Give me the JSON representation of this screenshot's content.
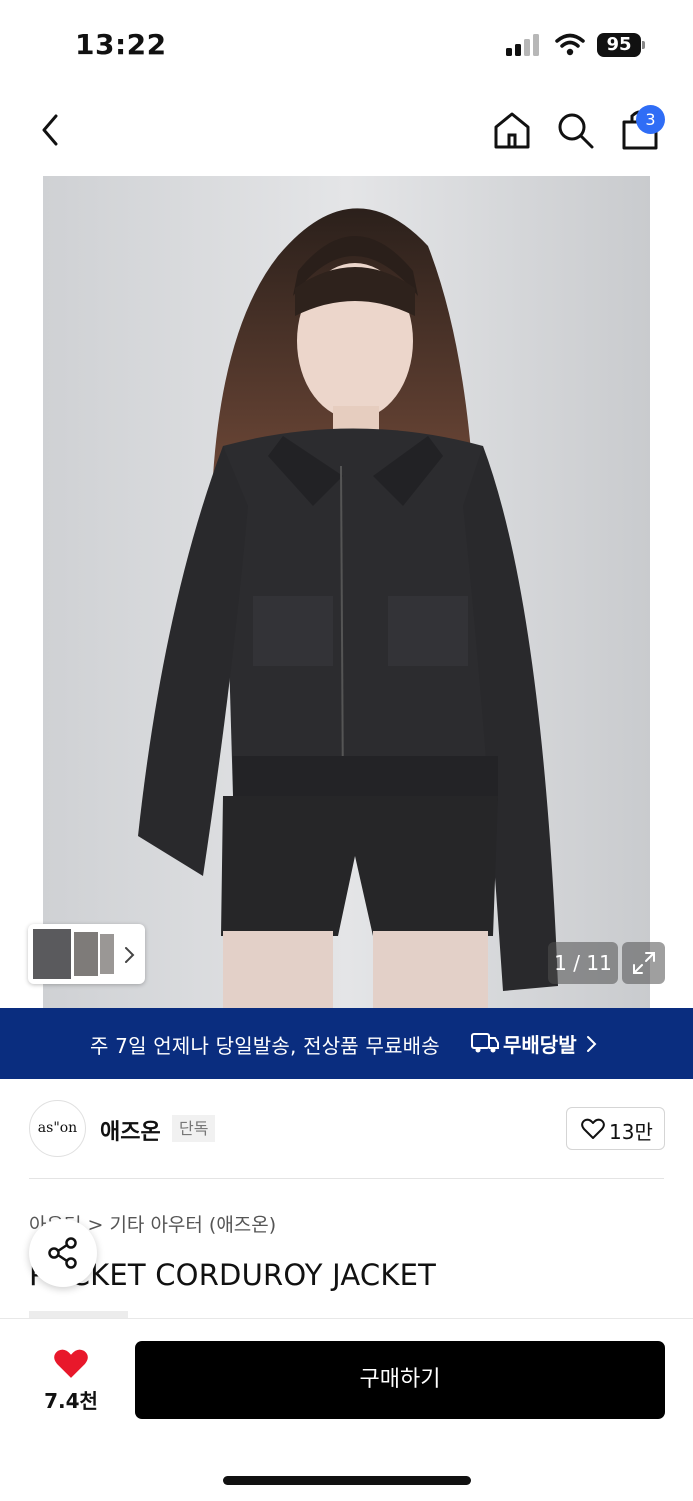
{
  "status_bar": {
    "time": "13:22",
    "battery": "95"
  },
  "header": {
    "cart_count": "3"
  },
  "gallery": {
    "counter": "1 / 11"
  },
  "promo": {
    "text": "주 7일 언제나 당일발송, 전상품 무료배송",
    "badge": "무배당발"
  },
  "brand": {
    "logo_text": "as\"on",
    "name": "애즈온",
    "tag": "단독",
    "likes": "13만"
  },
  "product": {
    "breadcrumb": "아우터 > 기타 아우터 (애즈온)",
    "title": "POCKET CORDUROY JACKET"
  },
  "bottom_bar": {
    "wish_count": "7.4천",
    "buy_label": "구매하기"
  },
  "colors": {
    "banner": "#0a2d7f",
    "badge_blue": "#2f6df6",
    "heart_red": "#e8182b",
    "buy_bg": "#000000"
  }
}
